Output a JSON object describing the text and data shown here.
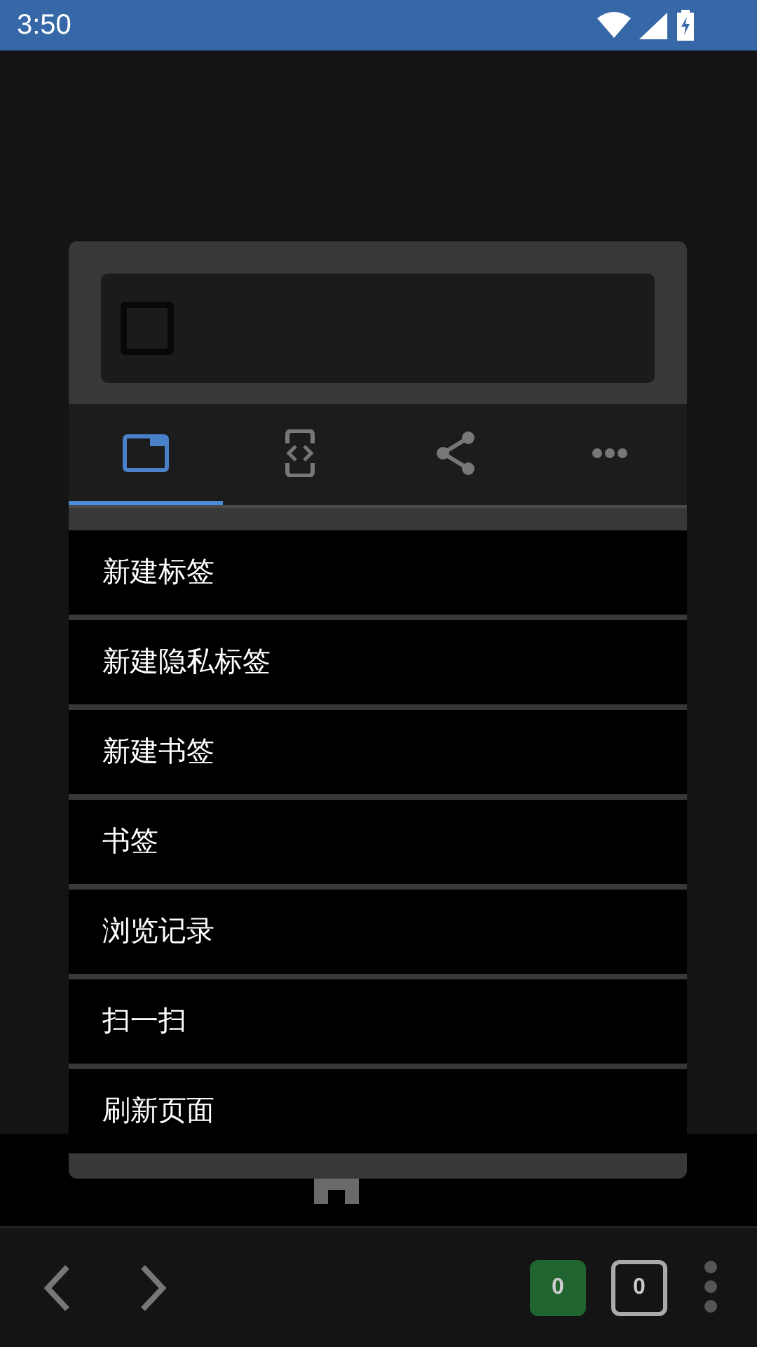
{
  "status_bar": {
    "time": "3:50"
  },
  "menu": {
    "tabs": [
      {
        "kind": "tabs",
        "selected": true
      },
      {
        "kind": "code",
        "selected": false
      },
      {
        "kind": "share",
        "selected": false
      },
      {
        "kind": "more",
        "selected": false
      }
    ],
    "items": [
      "新建标签",
      "新建隐私标签",
      "新建书签",
      "书签",
      "浏览记录",
      "扫一扫",
      "刷新页面"
    ]
  },
  "toolbar": {
    "badge": "0",
    "tab_count": "0"
  }
}
